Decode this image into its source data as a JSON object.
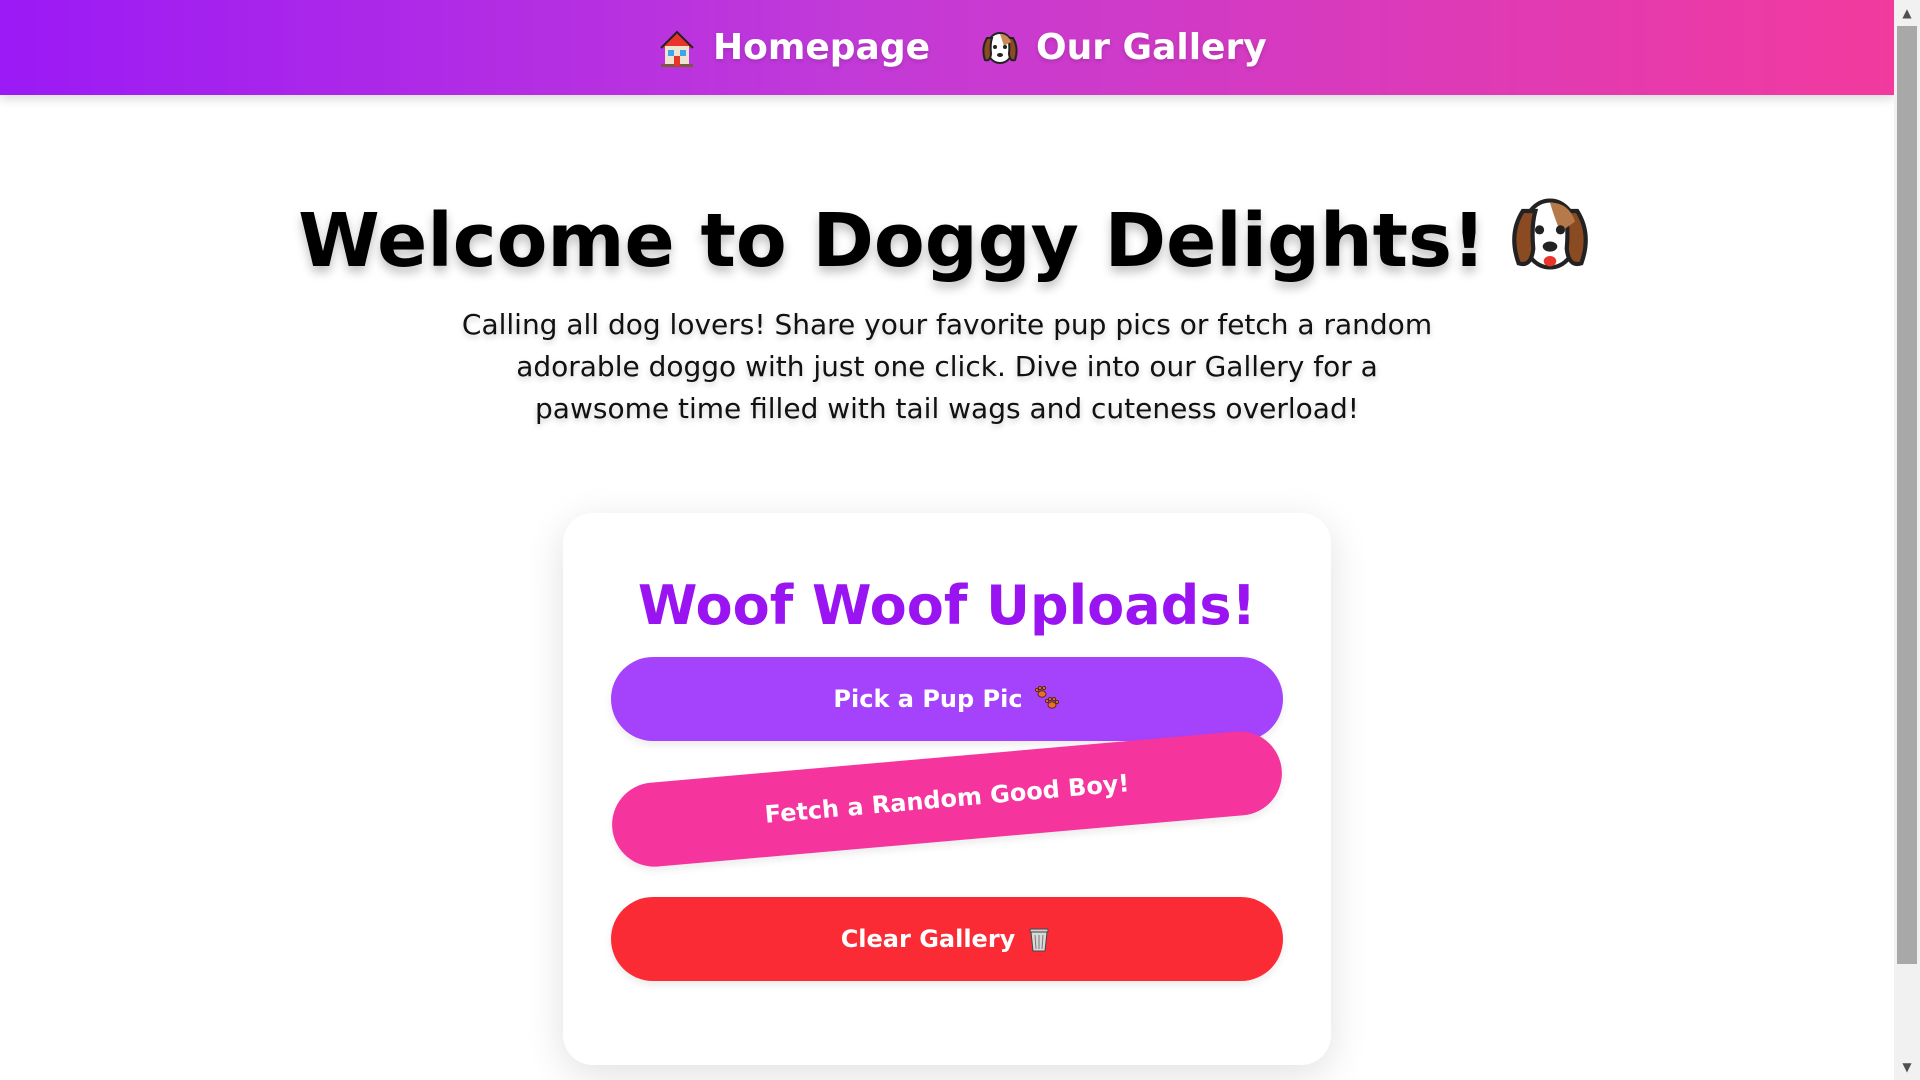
{
  "nav": {
    "home_label": "Homepage",
    "home_icon": "house-icon",
    "gallery_label": "Our Gallery",
    "gallery_icon": "dog-face-icon"
  },
  "hero": {
    "title": "Welcome to Doggy Delights!",
    "title_icon": "dog-face-icon",
    "description": "Calling all dog lovers! Share your favorite pup pics or fetch a random adorable doggo with just one click. Dive into our Gallery for a pawsome time filled with tail wags and cuteness overload!"
  },
  "card": {
    "title": "Woof Woof Uploads!",
    "pick_label": "Pick a Pup Pic",
    "pick_icon": "paw-prints-icon",
    "fetch_label": "Fetch a Random Good Boy!",
    "clear_label": "Clear Gallery",
    "clear_icon": "wastebasket-icon"
  },
  "colors": {
    "nav_gradient_start": "#9b1af5",
    "nav_gradient_end": "#f23a9e",
    "card_title": "#9a14f2",
    "pick_button": "#a443fb",
    "fetch_button": "#f5349e",
    "clear_button": "#fb2b36"
  }
}
